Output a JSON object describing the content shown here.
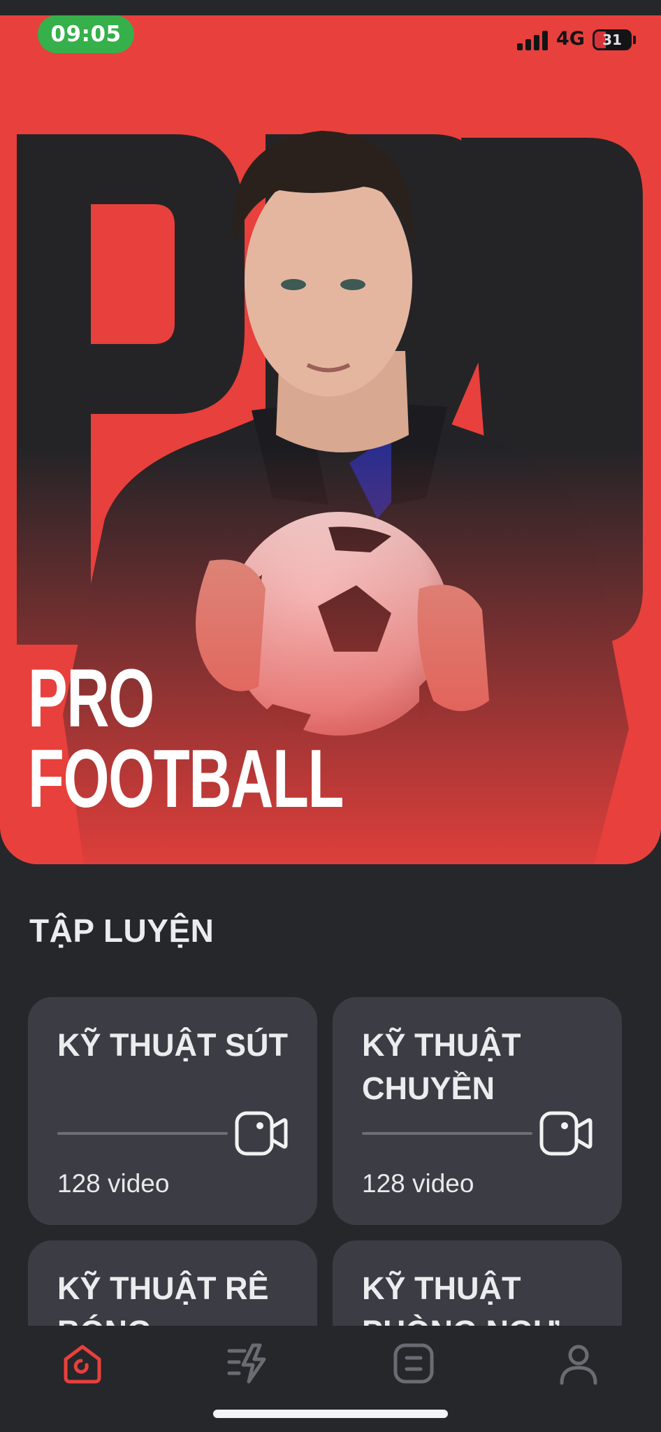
{
  "status_bar": {
    "time": "09:05",
    "network": "4G",
    "battery_level": "31",
    "battery_fraction": 0.31,
    "time_pill_color": "#35b04a"
  },
  "hero": {
    "background_word": "PRO",
    "title_line1": "PRO",
    "title_line2": "FOOTBALL",
    "background_color": "#e8403c"
  },
  "section": {
    "title": "TẬP LUYỆN"
  },
  "cards": [
    {
      "title": "KỸ THUẬT SÚT",
      "count": "128 video",
      "icon": "video-camera-icon"
    },
    {
      "title": "KỸ THUẬT CHUYỀN",
      "count": "128 video",
      "icon": "video-camera-icon"
    },
    {
      "title": "KỸ THUẬT RÊ BÓNG",
      "count": "",
      "icon": ""
    },
    {
      "title": "KỸ THUẬT PHÒNG NGỰ",
      "count": "",
      "icon": ""
    }
  ],
  "tabbar": {
    "items": [
      {
        "icon": "home-icon",
        "active": true
      },
      {
        "icon": "training-bolt-icon",
        "active": false
      },
      {
        "icon": "list-icon",
        "active": false
      },
      {
        "icon": "profile-icon",
        "active": false
      }
    ],
    "active_color": "#e8403c",
    "inactive_color": "#6b6c73"
  }
}
